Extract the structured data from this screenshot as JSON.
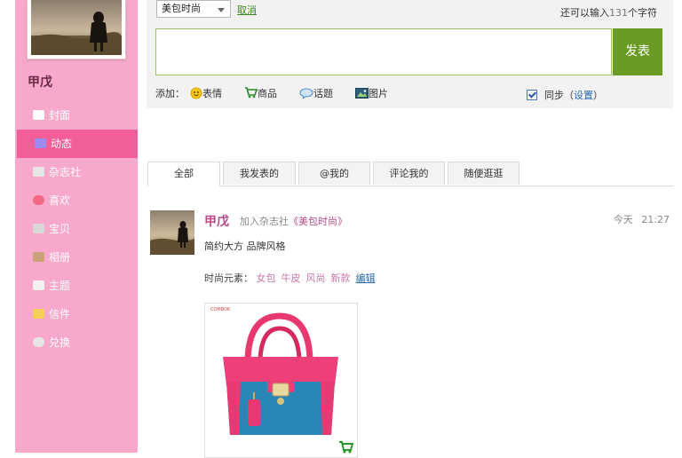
{
  "user": {
    "name": "甲戊"
  },
  "nav": [
    {
      "label": "封面",
      "icon": "home-icon",
      "color": "#ffffff"
    },
    {
      "label": "动态",
      "icon": "feed-icon",
      "color": "#9b8cf0",
      "active": true
    },
    {
      "label": "杂志社",
      "icon": "magazine-icon",
      "color": "#e0e0e0"
    },
    {
      "label": "喜欢",
      "icon": "heart-icon",
      "color": "#f06a86"
    },
    {
      "label": "宝贝",
      "icon": "cart-icon",
      "color": "#d9d9d9"
    },
    {
      "label": "相册",
      "icon": "album-icon",
      "color": "#c9a27a"
    },
    {
      "label": "主题",
      "icon": "theme-icon",
      "color": "#f0f0f0"
    },
    {
      "label": "信件",
      "icon": "mail-icon",
      "color": "#f5cf5a"
    },
    {
      "label": "兑换",
      "icon": "exchange-icon",
      "color": "#e0e0e0"
    }
  ],
  "composer": {
    "category_selected": "美包时尚",
    "cancel": "取消",
    "char_prefix": "还可以输入",
    "char_count": "131",
    "char_suffix": "个字符",
    "post_button": "发表",
    "add_label": "添加：",
    "add_items": [
      "表情",
      "商品",
      "话题",
      "图片"
    ],
    "sync_label": "同步（",
    "sync_settings": "设置",
    "sync_close": "）"
  },
  "tabs": [
    "全部",
    "我发表的",
    "@我的",
    "评论我的",
    "随便逛逛"
  ],
  "feed": {
    "user": "甲戊",
    "action_prefix": "加入杂志社",
    "magazine": "《美包时尚》",
    "date": "今天",
    "time": "21:27",
    "description": "简约大方 品牌风格",
    "tags_label": "时尚元素：",
    "tags": [
      "女包",
      "牛皮",
      "风尚",
      "新款"
    ],
    "edit": "编辑",
    "product_brand": "COMBOK"
  },
  "colors": {
    "sidebar_pink": "#f7a8cb",
    "nav_active": "#f25e98",
    "post_button": "#6a9c25",
    "username": "#b84a8a"
  }
}
